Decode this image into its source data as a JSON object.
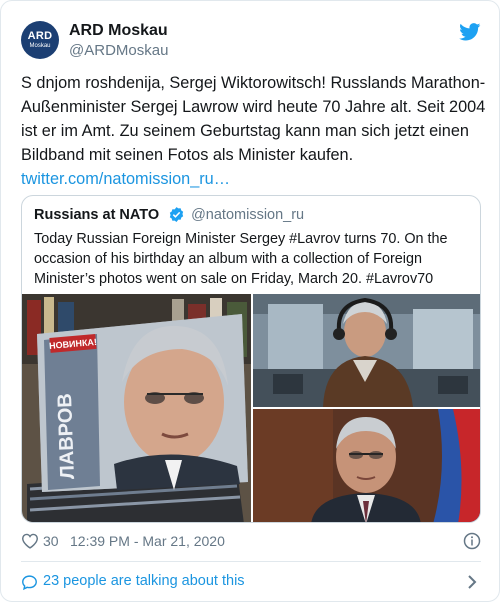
{
  "author": {
    "avatar_text": "ARD",
    "avatar_subtext": "Moskau",
    "name": "ARD Moskau",
    "handle": "@ARDMoskau"
  },
  "tweet": {
    "text": "S dnjom roshdenija, Sergej Wiktorowitsch! Russlands Marathon-Außenminister Sergej Lawrow wird heute 70 Jahre alt. Seit 2004 ist er im Amt. Zu seinem Geburtstag kann man sich jetzt einen Bildband mit seinen Fotos als Minister kaufen.",
    "link": "twitter.com/natomission_ru…"
  },
  "quoted_tweet": {
    "name": "Russians at NATO",
    "handle": "@natomission_ru",
    "text": "Today Russian Foreign Minister Sergey #Lavrov turns 70. On the occasion of his birthday an album with a collection of Foreign Minister’s photos went on sale on Friday, March 20. #Lavrov70",
    "book_badge": "НОВИНКА!",
    "book_title": "ЛАВРОВ"
  },
  "footer": {
    "likes": "30",
    "timestamp": "12:39 PM - Mar 21, 2020"
  },
  "conversation": {
    "label": "23 people are talking about this"
  },
  "icons": {
    "brand": "twitter-bird-icon",
    "verified": "verified-badge-icon",
    "like": "heart-icon",
    "info": "info-icon",
    "reply": "speech-bubble-icon",
    "open": "chevron-right-icon"
  },
  "colors": {
    "link": "#1b95e0",
    "secondary_text": "#657786",
    "border": "#e1e8ed",
    "avatar_bg": "#1c3f73"
  }
}
